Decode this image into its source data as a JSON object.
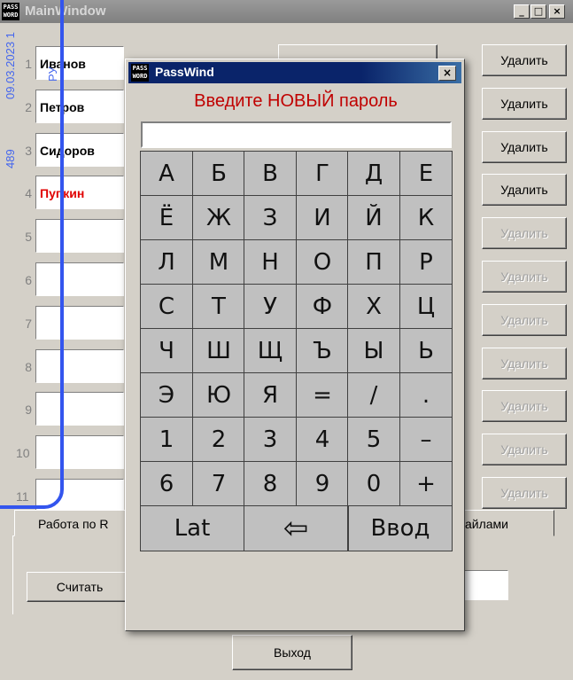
{
  "main_window": {
    "title": "MainWindow",
    "title_buttons": [
      "_",
      "□",
      "×"
    ],
    "side_overlay": {
      "date": "09.03.2023 1",
      "code": "489",
      "label": "РУ"
    },
    "rows": [
      {
        "num": "1",
        "name": "Иванов",
        "delete": "Удалить"
      },
      {
        "num": "2",
        "name": "Петров",
        "delete": "Удалить"
      },
      {
        "num": "3",
        "name": "Сидоров",
        "delete": "Удалить"
      },
      {
        "num": "4",
        "name": "Пупкин",
        "delete": "Удалить"
      },
      {
        "num": "5",
        "name": "",
        "delete": "Удалить"
      },
      {
        "num": "6",
        "name": "",
        "delete": "Удалить"
      },
      {
        "num": "7",
        "name": "",
        "delete": "Удалить"
      },
      {
        "num": "8",
        "name": "",
        "delete": "Удалить"
      },
      {
        "num": "9",
        "name": "",
        "delete": "Удалить"
      },
      {
        "num": "10",
        "name": "",
        "delete": "Удалить"
      },
      {
        "num": "11",
        "name": "",
        "delete": "Удалить"
      }
    ],
    "highlight_color": "#e00000",
    "tabs": [
      "Работа по R",
      "айлами"
    ],
    "read_button": "Считать",
    "exit_button": "Выход"
  },
  "dialog": {
    "title": "PassWind",
    "close": "×",
    "prompt": "Введите НОВЫЙ пароль",
    "password_value": "",
    "keys": [
      [
        "А",
        "Б",
        "В",
        "Г",
        "Д",
        "Е"
      ],
      [
        "Ё",
        "Ж",
        "З",
        "И",
        "Й",
        "К"
      ],
      [
        "Л",
        "М",
        "Н",
        "О",
        "П",
        "Р"
      ],
      [
        "С",
        "Т",
        "У",
        "Ф",
        "Х",
        "Ц"
      ],
      [
        "Ч",
        "Ш",
        "Щ",
        "Ъ",
        "Ы",
        "Ь"
      ],
      [
        "Э",
        "Ю",
        "Я",
        "=",
        "/",
        "."
      ],
      [
        "1",
        "2",
        "3",
        "4",
        "5",
        "–"
      ],
      [
        "6",
        "7",
        "8",
        "9",
        "0",
        "+"
      ]
    ],
    "bottom_keys": {
      "lat": "Lat",
      "backspace": "⇦",
      "enter": "Ввод"
    }
  },
  "icons": {
    "app": "passw-icon",
    "backspace": "left-arrow-icon"
  }
}
